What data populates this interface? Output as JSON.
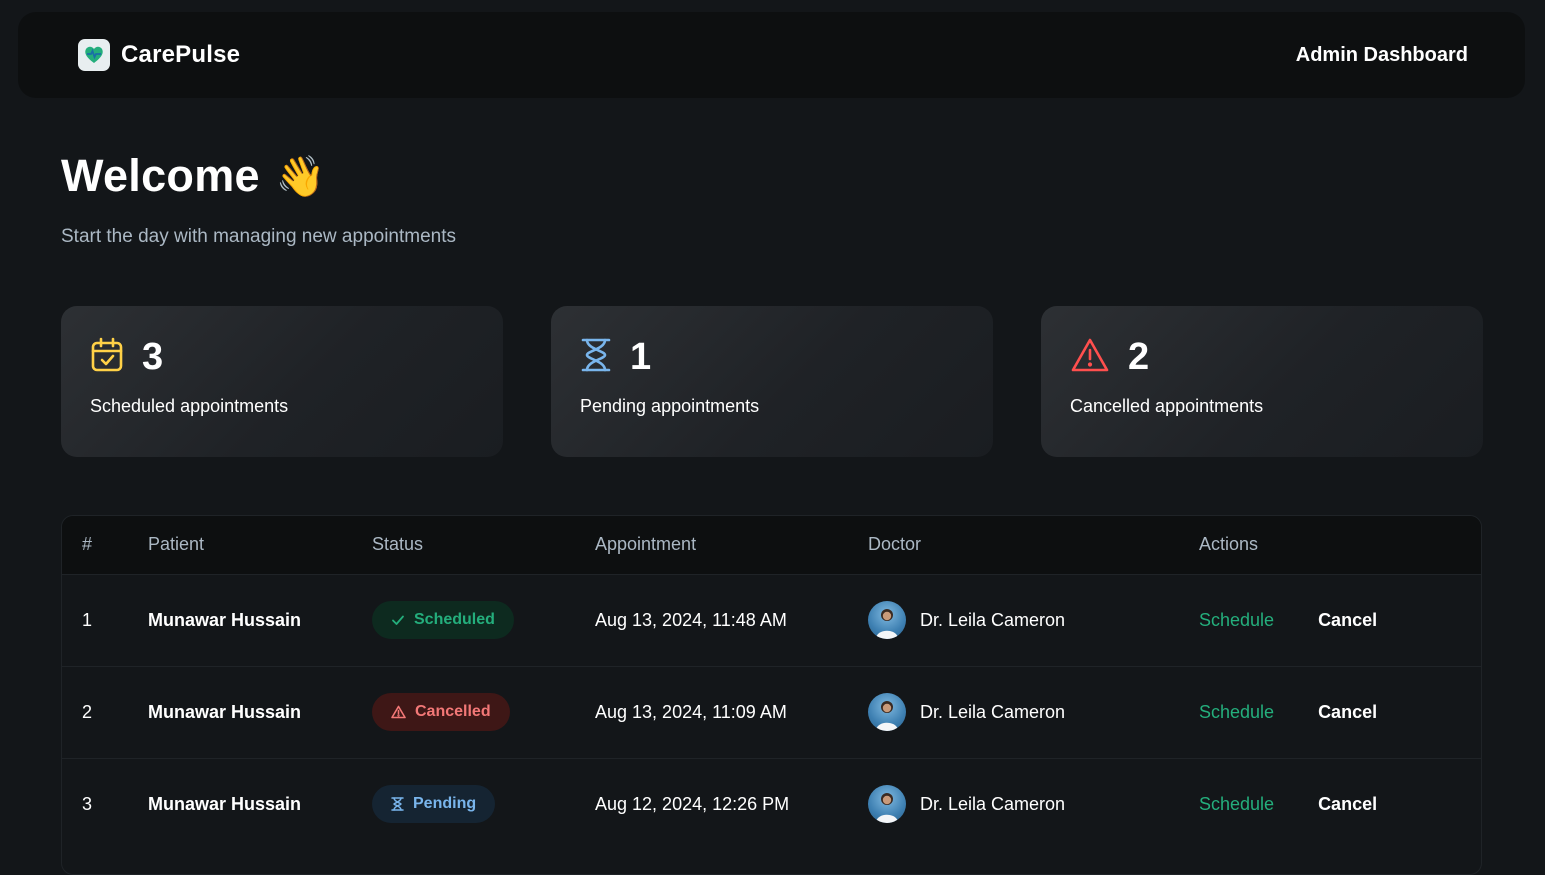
{
  "header": {
    "brand": "CarePulse",
    "logo_icon": "carepulse-logo-icon",
    "title": "Admin Dashboard"
  },
  "welcome": {
    "title": "Welcome",
    "emoji": "👋",
    "subtitle": "Start the day with managing new appointments"
  },
  "stats": [
    {
      "icon": "calendar-check-icon",
      "count": "3",
      "label": "Scheduled appointments",
      "color": "#ffd147"
    },
    {
      "icon": "hourglass-icon",
      "count": "1",
      "label": "Pending appointments",
      "color": "#79b5ec"
    },
    {
      "icon": "alert-triangle-icon",
      "count": "2",
      "label": "Cancelled appointments",
      "color": "#ff4f4e"
    }
  ],
  "table": {
    "headers": [
      "#",
      "Patient",
      "Status",
      "Appointment",
      "Doctor",
      "Actions"
    ],
    "rows": [
      {
        "num": "1",
        "patient": "Munawar Hussain",
        "status": "Scheduled",
        "date": "Aug 13, 2024, 11:48 AM",
        "doctor": "Dr. Leila Cameron",
        "schedule": "Schedule",
        "cancel": "Cancel"
      },
      {
        "num": "2",
        "patient": "Munawar Hussain",
        "status": "Cancelled",
        "date": "Aug 13, 2024, 11:09 AM",
        "doctor": "Dr. Leila Cameron",
        "schedule": "Schedule",
        "cancel": "Cancel"
      },
      {
        "num": "3",
        "patient": "Munawar Hussain",
        "status": "Pending",
        "date": "Aug 12, 2024, 12:26 PM",
        "doctor": "Dr. Leila Cameron",
        "schedule": "Schedule",
        "cancel": "Cancel"
      }
    ]
  },
  "colors": {
    "accent_green": "#24ae7c",
    "pending_blue": "#79b5ec",
    "cancel_red": "#f37877",
    "scheduled_yellow": "#ffd147"
  }
}
